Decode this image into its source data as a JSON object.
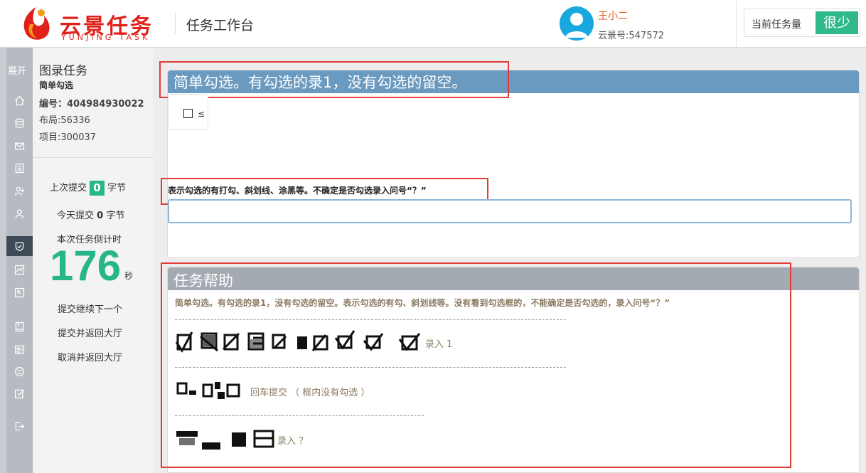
{
  "header": {
    "logo_cn": "云景任务",
    "logo_en": "YUNJING TASK",
    "workbench_title": "任务工作台",
    "user_name": "王小二",
    "user_id": "云景号:547572",
    "task_load_label": "当前任务量",
    "task_load_value": "很少"
  },
  "rail": {
    "expand_label": "展开",
    "icons": [
      "home-icon",
      "database-icon",
      "mail-icon",
      "document-icon",
      "add-user-icon",
      "user-icon",
      "shield-check-icon",
      "chart-icon",
      "external-icon",
      "book-icon",
      "id-card-icon",
      "sad-face-icon",
      "edit-icon",
      "logout-icon"
    ],
    "active_index": 6
  },
  "info": {
    "title": "图录任务",
    "subtitle": "简单勾选",
    "number_label": "编号：",
    "number_value": "404984930022",
    "layout": "布局:56336",
    "project": "项目:300037"
  },
  "stats": {
    "last_submit_prefix": "上次提交",
    "last_submit_count": "0",
    "last_submit_unit": "字节",
    "today_prefix": "今天提交",
    "today_count": "0",
    "today_unit": "字节",
    "countdown_label": "本次任务倒计时",
    "countdown_value": "176",
    "countdown_unit": "秒"
  },
  "actions": {
    "submit_next": "提交继续下一个",
    "submit_return": "提交并返回大厅",
    "cancel_return": "取消并返回大厅"
  },
  "task": {
    "heading": "简单勾选。有勾选的录1，没有勾选的留空。",
    "hint": "表示勾选的有打勾、斜划线、涂黑等。不确定是否勾选录入问号“？”",
    "input_value": "",
    "thumb_char": "≤"
  },
  "help": {
    "heading": "任务帮助",
    "description": "简单勾选。有勾选的录1，没有勾选的留空。表示勾选的有勾、斜划线等。没有看到勾选框的，不能确定是否勾选的，录入问号“？”",
    "example1": "录入 1",
    "example2": "回车提交 （ 框内没有勾选 ）",
    "example3": "录入 ？"
  },
  "colors": {
    "brand_red": "#e0201a",
    "accent_green": "#27b58a",
    "task_head_blue": "#6b9ac0",
    "help_head_gray": "#a3aab2",
    "annotation_red": "#e33a3a"
  }
}
